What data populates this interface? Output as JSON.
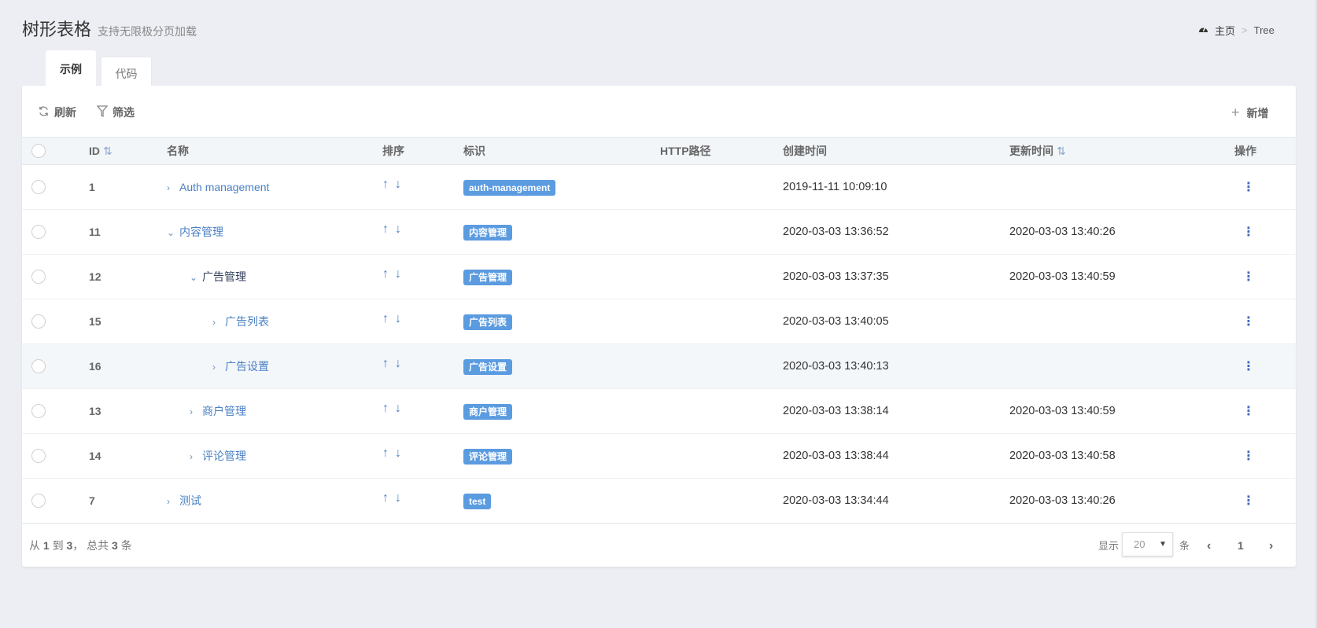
{
  "header": {
    "title": "树形表格",
    "subtitle": "支持无限极分页加载"
  },
  "breadcrumb": {
    "home": "主页",
    "separator": ">",
    "current": "Tree"
  },
  "tabs": [
    {
      "label": "示例",
      "active": true
    },
    {
      "label": "代码",
      "active": false
    }
  ],
  "toolbar": {
    "refresh": "刷新",
    "filter": "筛选",
    "add": "新增"
  },
  "columns": {
    "id": "ID",
    "name": "名称",
    "order": "排序",
    "slug": "标识",
    "http_path": "HTTP路径",
    "created_at": "创建时间",
    "updated_at": "更新时间",
    "actions": "操作"
  },
  "rows": [
    {
      "id": "1",
      "name": "Auth management",
      "level": 0,
      "expanded": false,
      "slug": "auth-management",
      "created": "2019-11-11 10:09:10",
      "updated": ""
    },
    {
      "id": "11",
      "name": "内容管理",
      "level": 0,
      "expanded": true,
      "slug": "内容管理",
      "created": "2020-03-03 13:36:52",
      "updated": "2020-03-03 13:40:26"
    },
    {
      "id": "12",
      "name": "广告管理",
      "level": 1,
      "expanded": true,
      "slug": "广告管理",
      "created": "2020-03-03 13:37:35",
      "updated": "2020-03-03 13:40:59"
    },
    {
      "id": "15",
      "name": "广告列表",
      "level": 2,
      "expanded": false,
      "slug": "广告列表",
      "created": "2020-03-03 13:40:05",
      "updated": ""
    },
    {
      "id": "16",
      "name": "广告设置",
      "level": 2,
      "expanded": false,
      "slug": "广告设置",
      "created": "2020-03-03 13:40:13",
      "updated": "",
      "highlight": true
    },
    {
      "id": "13",
      "name": "商户管理",
      "level": 1,
      "expanded": false,
      "slug": "商户管理",
      "created": "2020-03-03 13:38:14",
      "updated": "2020-03-03 13:40:59"
    },
    {
      "id": "14",
      "name": "评论管理",
      "level": 1,
      "expanded": false,
      "slug": "评论管理",
      "created": "2020-03-03 13:38:44",
      "updated": "2020-03-03 13:40:58"
    },
    {
      "id": "7",
      "name": "测试",
      "level": 0,
      "expanded": false,
      "slug": "test",
      "created": "2020-03-03 13:34:44",
      "updated": "2020-03-03 13:40:26"
    }
  ],
  "footer": {
    "from_label": "从",
    "from": "1",
    "to_label": "到",
    "to": "3",
    "total_label": "， 总共",
    "total": "3",
    "unit": "条",
    "show_label": "显示",
    "per_page": "20",
    "per_page_unit": "条",
    "current_page": "1"
  },
  "colors": {
    "accent": "#5b9be0",
    "link": "#4a80c4",
    "background": "#eceef3"
  }
}
